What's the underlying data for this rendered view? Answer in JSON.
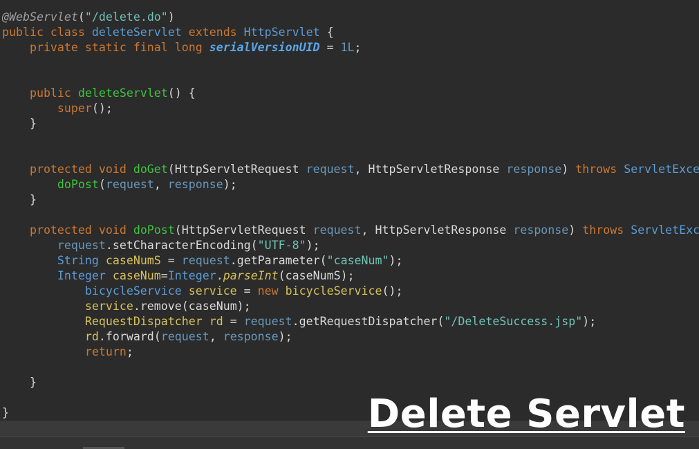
{
  "editor": {
    "theme": {
      "background": "#2b2b2b",
      "current_line": "#3a3a3a",
      "default": "#d9d9d9",
      "keyword": "#cc7832",
      "method": "#3fc43f",
      "type": "#5b9bd5",
      "param": "#6897bb",
      "string": "#6fc3b6",
      "annotation": "#a0a0a0",
      "field": "#5aa6e8",
      "builtin": "#cc7832",
      "number": "#6897bb",
      "call": "#d6c15a"
    },
    "lines": [
      [
        {
          "t": "@WebServlet",
          "c": "annotation",
          "i": true
        },
        {
          "t": "(",
          "c": "default"
        },
        {
          "t": "\"/delete.do\"",
          "c": "string"
        },
        {
          "t": ")",
          "c": "default"
        }
      ],
      [
        {
          "t": "public class ",
          "c": "keyword"
        },
        {
          "t": "deleteServlet",
          "c": "type"
        },
        {
          "t": " extends ",
          "c": "keyword"
        },
        {
          "t": "HttpServlet",
          "c": "type"
        },
        {
          "t": " {",
          "c": "default"
        }
      ],
      [
        {
          "t": "    private static final long ",
          "c": "keyword"
        },
        {
          "t": "serialVersionUID",
          "c": "field",
          "i": true,
          "b": true
        },
        {
          "t": " = ",
          "c": "default"
        },
        {
          "t": "1L",
          "c": "number"
        },
        {
          "t": ";",
          "c": "default"
        }
      ],
      [],
      [],
      [
        {
          "t": "    public ",
          "c": "keyword"
        },
        {
          "t": "deleteServlet",
          "c": "method"
        },
        {
          "t": "() {",
          "c": "default"
        }
      ],
      [
        {
          "t": "        super",
          "c": "keyword"
        },
        {
          "t": "();",
          "c": "default"
        }
      ],
      [
        {
          "t": "    }",
          "c": "default"
        }
      ],
      [],
      [],
      [
        {
          "t": "    protected void ",
          "c": "keyword"
        },
        {
          "t": "doGet",
          "c": "method"
        },
        {
          "t": "(",
          "c": "default"
        },
        {
          "t": "HttpServletRequest",
          "c": "default"
        },
        {
          "t": " request",
          "c": "param"
        },
        {
          "t": ", ",
          "c": "default"
        },
        {
          "t": "HttpServletResponse",
          "c": "default"
        },
        {
          "t": " response",
          "c": "param"
        },
        {
          "t": ") ",
          "c": "default"
        },
        {
          "t": "throws ",
          "c": "keyword"
        },
        {
          "t": "ServletExce",
          "c": "type"
        }
      ],
      [
        {
          "t": "        doPost",
          "c": "method"
        },
        {
          "t": "(",
          "c": "default"
        },
        {
          "t": "request",
          "c": "param"
        },
        {
          "t": ", ",
          "c": "default"
        },
        {
          "t": "response",
          "c": "param"
        },
        {
          "t": ");",
          "c": "default"
        }
      ],
      [
        {
          "t": "    }",
          "c": "default"
        }
      ],
      [],
      [
        {
          "t": "    protected void ",
          "c": "keyword"
        },
        {
          "t": "doPost",
          "c": "method"
        },
        {
          "t": "(",
          "c": "default"
        },
        {
          "t": "HttpServletRequest",
          "c": "default"
        },
        {
          "t": " request",
          "c": "param"
        },
        {
          "t": ", ",
          "c": "default"
        },
        {
          "t": "HttpServletResponse",
          "c": "default"
        },
        {
          "t": " response",
          "c": "param"
        },
        {
          "t": ") ",
          "c": "default"
        },
        {
          "t": "throws ",
          "c": "keyword"
        },
        {
          "t": "ServletExce",
          "c": "type"
        }
      ],
      [
        {
          "t": "        request",
          "c": "param"
        },
        {
          "t": ".setCharacterEncoding(",
          "c": "default"
        },
        {
          "t": "\"UTF-8\"",
          "c": "string"
        },
        {
          "t": ");",
          "c": "default"
        }
      ],
      [
        {
          "t": "        String",
          "c": "type"
        },
        {
          "t": " caseNumS",
          "c": "call"
        },
        {
          "t": " = ",
          "c": "default"
        },
        {
          "t": "request",
          "c": "param"
        },
        {
          "t": ".getParameter(",
          "c": "default"
        },
        {
          "t": "\"caseNum\"",
          "c": "string"
        },
        {
          "t": ");",
          "c": "default"
        }
      ],
      [
        {
          "t": "        Integer",
          "c": "type"
        },
        {
          "t": " caseNum",
          "c": "call"
        },
        {
          "t": "=",
          "c": "default"
        },
        {
          "t": "Integer",
          "c": "type"
        },
        {
          "t": ".",
          "c": "default"
        },
        {
          "t": "parseInt",
          "c": "call",
          "i": true
        },
        {
          "t": "(caseNumS);",
          "c": "default"
        }
      ],
      [
        {
          "t": "            bicycleService",
          "c": "type"
        },
        {
          "t": " service",
          "c": "call"
        },
        {
          "t": " = ",
          "c": "default"
        },
        {
          "t": "new ",
          "c": "keyword"
        },
        {
          "t": "bicycleService",
          "c": "call"
        },
        {
          "t": "();",
          "c": "default"
        }
      ],
      [
        {
          "t": "            service",
          "c": "call"
        },
        {
          "t": ".remove(caseNum);",
          "c": "default"
        }
      ],
      [
        {
          "t": "            RequestDispatcher",
          "c": "call"
        },
        {
          "t": " rd",
          "c": "call"
        },
        {
          "t": " = ",
          "c": "default"
        },
        {
          "t": "request",
          "c": "param"
        },
        {
          "t": ".getRequestDispatcher(",
          "c": "default"
        },
        {
          "t": "\"/DeleteSuccess.jsp\"",
          "c": "string"
        },
        {
          "t": ");",
          "c": "default"
        }
      ],
      [
        {
          "t": "            rd",
          "c": "call"
        },
        {
          "t": ".forward(",
          "c": "default"
        },
        {
          "t": "request",
          "c": "param"
        },
        {
          "t": ", ",
          "c": "default"
        },
        {
          "t": "response",
          "c": "param"
        },
        {
          "t": ");",
          "c": "default"
        }
      ],
      [
        {
          "t": "            return",
          "c": "keyword"
        },
        {
          "t": ";",
          "c": "default"
        }
      ],
      [],
      [
        {
          "t": "    }",
          "c": "default"
        }
      ],
      [],
      [
        {
          "t": "}",
          "c": "default"
        }
      ]
    ]
  },
  "overlay": {
    "title": "Delete Servlet"
  }
}
